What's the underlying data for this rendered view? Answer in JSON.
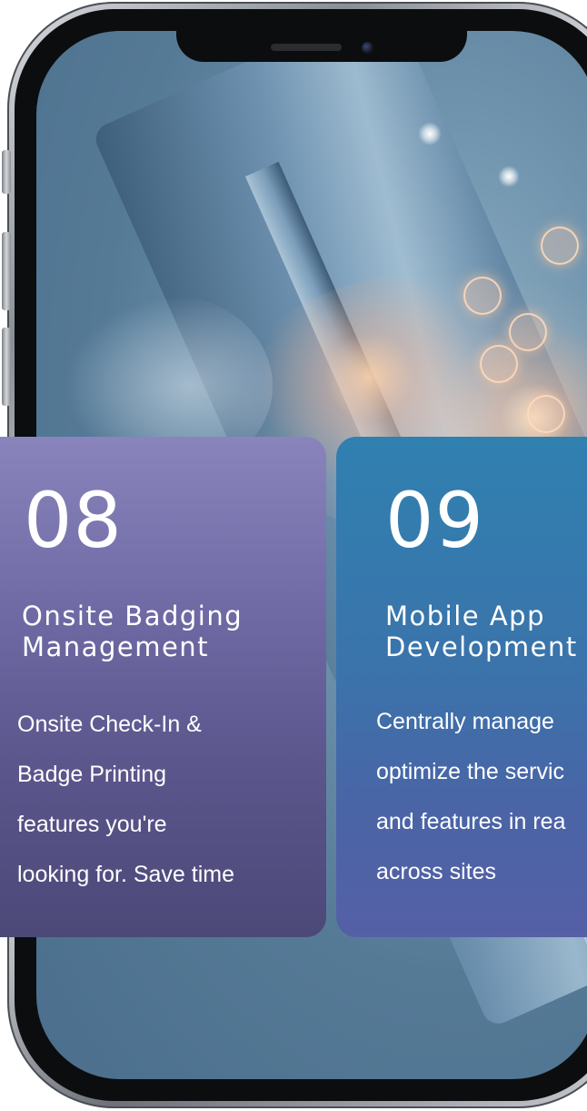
{
  "cards": [
    {
      "number": "08",
      "title": "Onsite Badging\nManagement",
      "description": "Onsite Check-In &\nBadge Printing\nfeatures you're\nlooking  for. Save time"
    },
    {
      "number": "09",
      "title": "Mobile App\nDevelopment",
      "description": "Centrally manage\noptimize the servic\nand features in rea\nacross sites"
    }
  ],
  "icons": {
    "phone": "phone-frame-icon",
    "camera": "front-camera-icon",
    "speaker": "earpiece-speaker-icon",
    "network_node": "user-network-node-icon"
  },
  "colors": {
    "card_08_top": "#8a84bc",
    "card_08_bottom": "#4c4878",
    "card_09_top": "#3080b0",
    "card_09_bottom": "#5560a6",
    "screen_background": "#557a96",
    "text": "#ffffff"
  }
}
